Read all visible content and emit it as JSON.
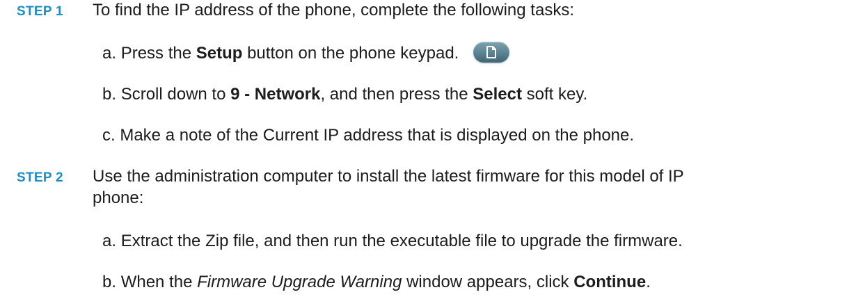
{
  "step1": {
    "label": "STEP 1",
    "intro": "To find the IP address of the phone, complete the following tasks:",
    "a": {
      "prefix": "a.",
      "pre": "Press the ",
      "bold": "Setup",
      "post": " button on the phone keypad.",
      "icon": "setup-page-icon"
    },
    "b": {
      "prefix": "b.",
      "pre": "Scroll down to ",
      "bold1": "9 - Network",
      "mid": ", and then press the ",
      "bold2": "Select",
      "post": " soft key."
    },
    "c": {
      "prefix": "c.",
      "text": "Make a note of the Current IP address that is displayed on the phone."
    }
  },
  "step2": {
    "label": "STEP 2",
    "intro_line1": "Use the administration computer to install the latest firmware for this model of IP",
    "intro_line2": "phone:",
    "a": {
      "prefix": "a.",
      "text": "Extract the Zip file, and then run the executable file to upgrade the firmware."
    },
    "b": {
      "prefix": "b.",
      "pre": "When the ",
      "italic": "Firmware Upgrade Warning",
      "mid": " window appears, click ",
      "bold": "Continue",
      "post": "."
    }
  },
  "colors": {
    "step_label": "#1b8fc6",
    "body_text": "#1c1c1c",
    "key_button": "#5a8494"
  }
}
